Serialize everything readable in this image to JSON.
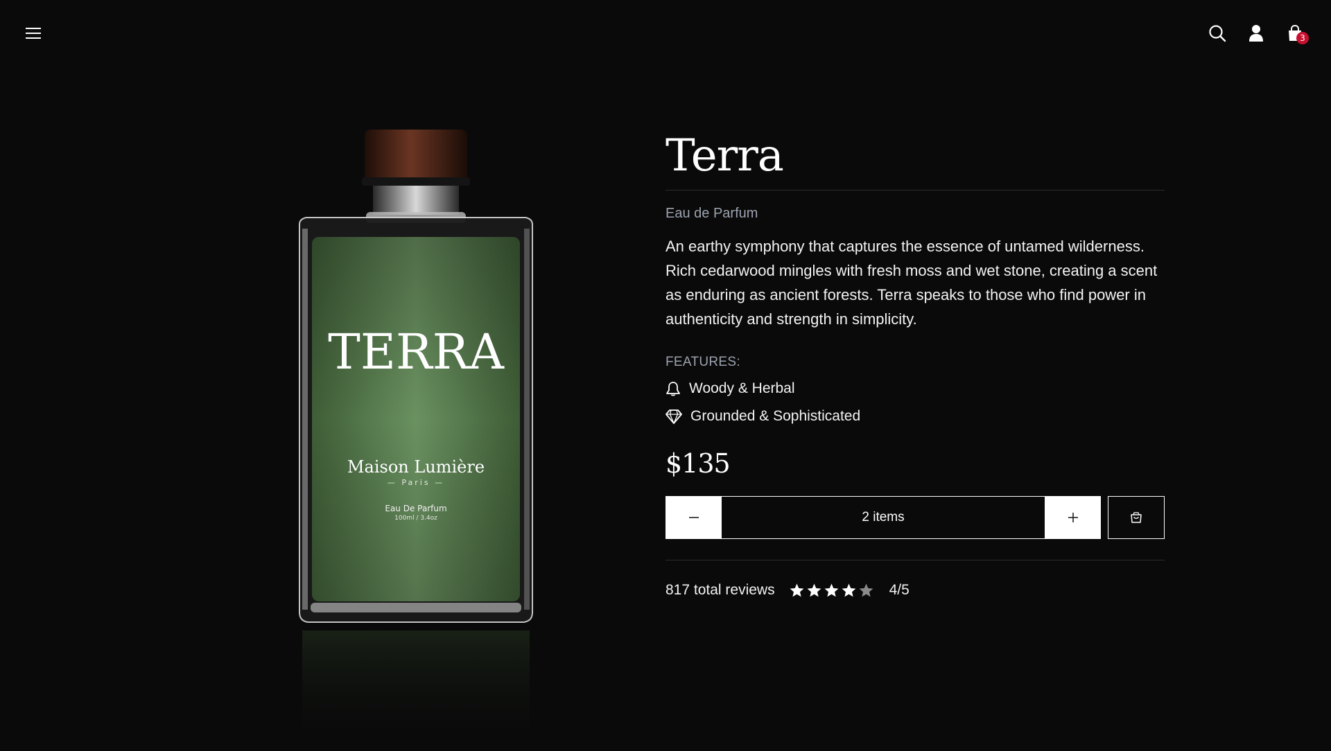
{
  "header": {
    "menu_icon": "hamburger-menu-icon",
    "search_icon": "search-icon",
    "account_icon": "user-icon",
    "cart_icon": "shopping-bag-icon",
    "cart_count": "3"
  },
  "product_image": {
    "bottle_label": "TERRA",
    "brand": "Maison Lumière",
    "city": "— Paris —",
    "type": "Eau De Parfum",
    "volume": "100ml / 3.4oz",
    "liquid_color": "#5b7f4f",
    "cap_color": "#4a2417"
  },
  "product": {
    "title": "Terra",
    "subtitle": "Eau de Parfum",
    "description": "An earthy symphony that captures the essence of untamed wilderness. Rich cedarwood mingles with fresh moss and wet stone, creating a scent as enduring as ancient forests. Terra speaks to those who find power in authenticity and strength in simplicity.",
    "features_label": "FEATURES:",
    "features": [
      {
        "icon": "bell-icon",
        "label": "Woody & Herbal"
      },
      {
        "icon": "diamond-icon",
        "label": "Grounded & Sophisticated"
      }
    ],
    "price": "$135"
  },
  "purchase": {
    "decrement_icon": "minus-icon",
    "quantity_label": "2 items",
    "increment_icon": "plus-icon",
    "add_to_cart_icon": "shopping-bag-icon"
  },
  "reviews": {
    "count_label": "817 total reviews",
    "rating": 4,
    "max_rating": 5,
    "rating_label": "4/5",
    "star_color": "#ffffff",
    "empty_star_color": "#8a8a8a"
  }
}
